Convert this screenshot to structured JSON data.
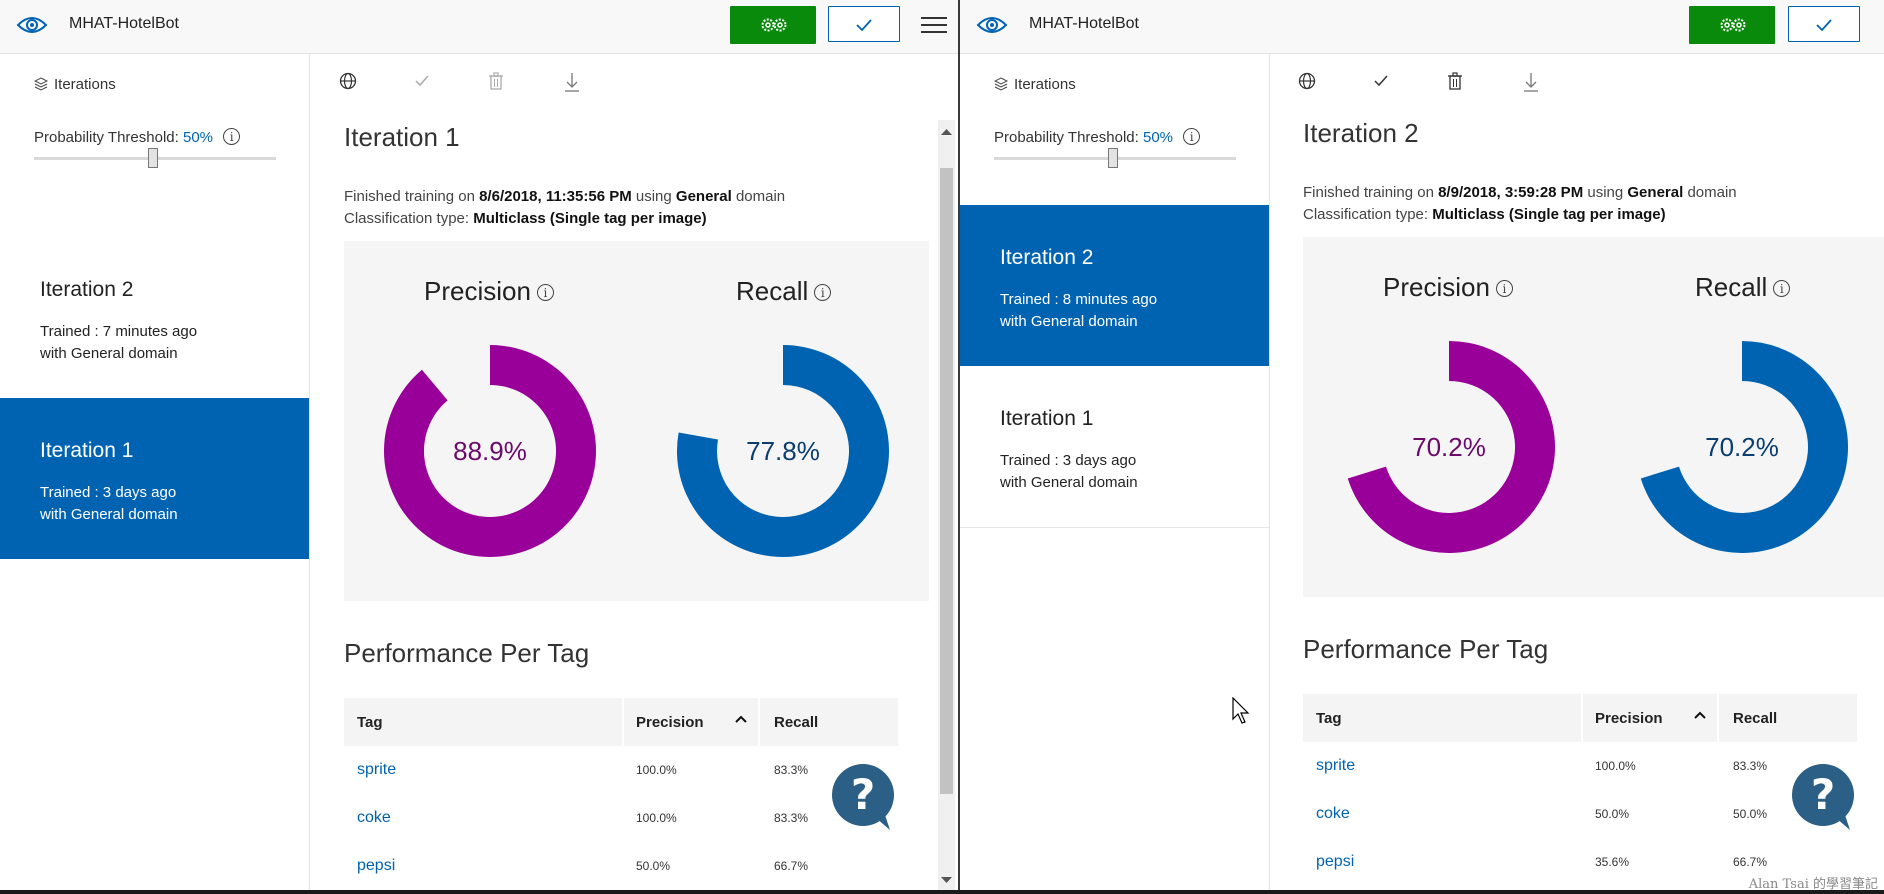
{
  "colors": {
    "accent": "#0063b1",
    "train_green": "#0a8a0a",
    "precision_purple": "#990099",
    "recall_blue": "#0063b1"
  },
  "panes": [
    {
      "app_title": "MHAT-HotelBot",
      "sidebar": {
        "iterations_label": "Iterations",
        "threshold_label": "Probability Threshold:",
        "threshold_value": "50%",
        "threshold_fraction": 0.5,
        "items": [
          {
            "name": "Iteration 2",
            "trained": "Trained : 7 minutes ago",
            "domain": "with General domain",
            "selected": false
          },
          {
            "name": "Iteration 1",
            "trained": "Trained : 3 days ago",
            "domain": "with General domain",
            "selected": true
          }
        ]
      },
      "main": {
        "title": "Iteration 1",
        "finished_prefix": "Finished training on",
        "finished_date": "8/6/2018, 11:35:56 PM",
        "using": "using",
        "domain": "General",
        "domain_suffix": "domain",
        "class_prefix": "Classification type:",
        "class_type": "Multiclass (Single tag per image)",
        "precision_label": "Precision",
        "recall_label": "Recall",
        "precision_value": "88.9%",
        "precision_fraction": 0.889,
        "recall_value": "77.8%",
        "recall_fraction": 0.778,
        "perf_title": "Performance Per Tag",
        "table": {
          "headers": [
            "Tag",
            "Precision",
            "Recall"
          ],
          "rows": [
            {
              "tag": "sprite",
              "precision": "100.0%",
              "recall": "83.3%"
            },
            {
              "tag": "coke",
              "precision": "100.0%",
              "recall": "83.3%"
            },
            {
              "tag": "pepsi",
              "precision": "50.0%",
              "recall": "66.7%"
            }
          ]
        }
      }
    },
    {
      "app_title": "MHAT-HotelBot",
      "sidebar": {
        "iterations_label": "Iterations",
        "threshold_label": "Probability Threshold:",
        "threshold_value": "50%",
        "threshold_fraction": 0.5,
        "items": [
          {
            "name": "Iteration 2",
            "trained": "Trained : 8 minutes ago",
            "domain": "with General domain",
            "selected": true
          },
          {
            "name": "Iteration 1",
            "trained": "Trained : 3 days ago",
            "domain": "with General domain",
            "selected": false
          }
        ]
      },
      "main": {
        "title": "Iteration 2",
        "finished_prefix": "Finished training on",
        "finished_date": "8/9/2018, 3:59:28 PM",
        "using": "using",
        "domain": "General",
        "domain_suffix": "domain",
        "class_prefix": "Classification type:",
        "class_type": "Multiclass (Single tag per image)",
        "precision_label": "Precision",
        "recall_label": "Recall",
        "precision_value": "70.2%",
        "precision_fraction": 0.702,
        "recall_value": "70.2%",
        "recall_fraction": 0.702,
        "perf_title": "Performance Per Tag",
        "table": {
          "headers": [
            "Tag",
            "Precision",
            "Recall"
          ],
          "rows": [
            {
              "tag": "sprite",
              "precision": "100.0%",
              "recall": "83.3%"
            },
            {
              "tag": "coke",
              "precision": "50.0%",
              "recall": "50.0%"
            },
            {
              "tag": "pepsi",
              "precision": "35.6%",
              "recall": "66.7%"
            }
          ]
        }
      }
    }
  ],
  "watermark": "Alan Tsai 的學習筆記"
}
